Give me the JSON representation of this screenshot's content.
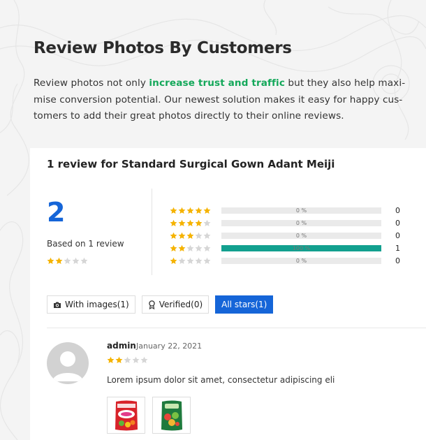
{
  "hero": {
    "title": "Review Photos By Customers",
    "desc_before": "Review photos not only ",
    "desc_highlight": "increase trust and traffic",
    "desc_after": " but they also help maxi-mise conversion potential. Our newest solution makes it easy for happy cus-tomers to add their great photos directly to their online reviews.",
    "highlight_color": "#14a85a"
  },
  "card": {
    "title": "1 review for Standard Surgical Gown Adant Meiji",
    "average": "2",
    "based_on": "Based on 1 review",
    "average_rating": 2,
    "breakdown": [
      {
        "stars": 5,
        "percent_label": "0 %",
        "fraction": 0.0,
        "count": "0"
      },
      {
        "stars": 4,
        "percent_label": "0 %",
        "fraction": 0.0,
        "count": "0"
      },
      {
        "stars": 3,
        "percent_label": "0 %",
        "fraction": 0.0,
        "count": "0"
      },
      {
        "stars": 2,
        "percent_label": "100 %",
        "fraction": 1.0,
        "count": "1"
      },
      {
        "stars": 1,
        "percent_label": "0 %",
        "fraction": 0.0,
        "count": "0"
      }
    ],
    "filters": {
      "with_images": "With images(1)",
      "verified": "Verified(0)",
      "all_stars": "All stars(1)"
    },
    "review": {
      "author": "admin",
      "date": "January 22, 2021",
      "rating": 2,
      "text": "Lorem ipsum dolor sit amet, consectetur adipiscing eli",
      "thumbnails": [
        "giggle-snack-pack-photo",
        "green-snack-pack-photo"
      ]
    }
  },
  "colors": {
    "accent_blue": "#1565d8",
    "star_gold": "#f5b301",
    "star_empty": "#d6d6d6",
    "bar_fill": "#12a08f"
  },
  "icons": [
    "camera-icon",
    "ribbon-badge-icon",
    "star-icon",
    "avatar-placeholder-icon"
  ]
}
